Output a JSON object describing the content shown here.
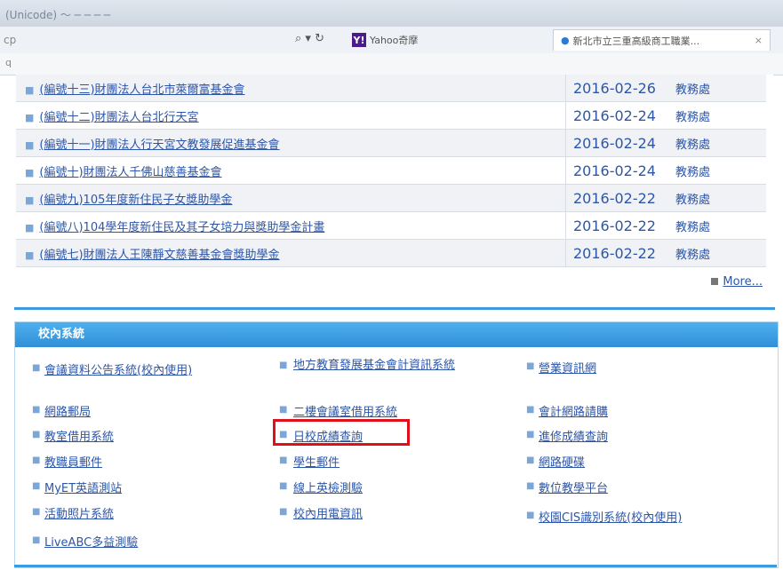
{
  "browser": {
    "window_title": "(Unicode)  ～  ─  ─  ─  ─",
    "address_fragment": "cp",
    "menu_fragment": "q",
    "search_icon": "⌕ ▾ ↻",
    "yahoo_tab_label": "Yahoo奇摩",
    "active_tab_label": "新北市立三重高級商工職業...",
    "active_tab_close": "×"
  },
  "news": {
    "rows": [
      {
        "title": "(編號十三)財團法人台北市萊爾富基金會",
        "date": "2016-02-26",
        "dept": "教務處"
      },
      {
        "title": "(編號十二)財團法人台北行天宮",
        "date": "2016-02-24",
        "dept": "教務處"
      },
      {
        "title": "(編號十一)財團法人行天宮文教發展促進基金會",
        "date": "2016-02-24",
        "dept": "教務處"
      },
      {
        "title": "(編號十)財團法人千佛山慈善基金會",
        "date": "2016-02-24",
        "dept": "教務處"
      },
      {
        "title": "(編號九)105年度新住民子女獎助學金",
        "date": "2016-02-22",
        "dept": "教務處"
      },
      {
        "title": "(編號八)104學年度新住民及其子女培力與獎助學金計畫",
        "date": "2016-02-22",
        "dept": "教務處"
      },
      {
        "title": "(編號七)財團法人王陳靜文慈善基金會獎助學金",
        "date": "2016-02-22",
        "dept": "教務處"
      }
    ],
    "more_label": "More..."
  },
  "systems": {
    "header": "校內系統",
    "col1": [
      "會議資料公告系統(校內使用)",
      "網路郵局",
      "教室借用系統",
      "教職員郵件",
      "MyET英語測站",
      "活動照片系統",
      "LiveABC多益測驗"
    ],
    "col2": [
      "地方教育發展基金會計資訊系統",
      "二樓會議室借用系統",
      "日校成績查詢",
      "學生郵件",
      "線上英檢測驗",
      "校內用電資訊"
    ],
    "col3": [
      "營業資訊網",
      "會計網路請購",
      "進修成績查詢",
      "網路硬碟",
      "數位教學平台",
      "校園CIS識別系統(校內使用)"
    ]
  }
}
